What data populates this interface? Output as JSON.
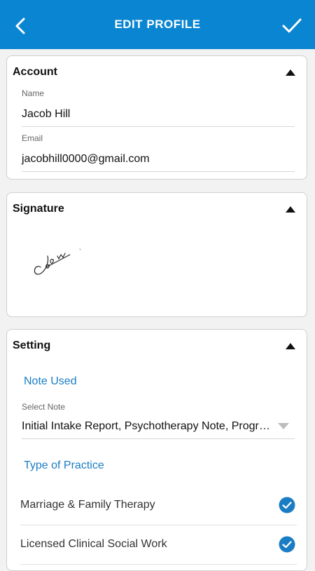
{
  "header": {
    "title": "EDIT PROFILE",
    "back_icon": "back-arrow-icon",
    "save_icon": "checkmark-icon"
  },
  "account": {
    "title": "Account",
    "name_label": "Name",
    "name_value": "Jacob Hill",
    "email_label": "Email",
    "email_value": "jacobhill0000@gmail.com"
  },
  "signature": {
    "title": "Signature"
  },
  "setting": {
    "title": "Setting",
    "note_used": "Note Used",
    "select_note_label": "Select Note",
    "select_note_value": "Initial Intake Report, Psychotherapy Note, Progress Note",
    "type_of_practice": "Type of Practice",
    "practices": [
      {
        "label": "Marriage & Family Therapy",
        "checked": true
      },
      {
        "label": "Licensed Clinical Social Work",
        "checked": true
      }
    ]
  },
  "colors": {
    "primary": "#0a85d2",
    "link": "#1a7dc4",
    "check": "#1a7dc4"
  }
}
